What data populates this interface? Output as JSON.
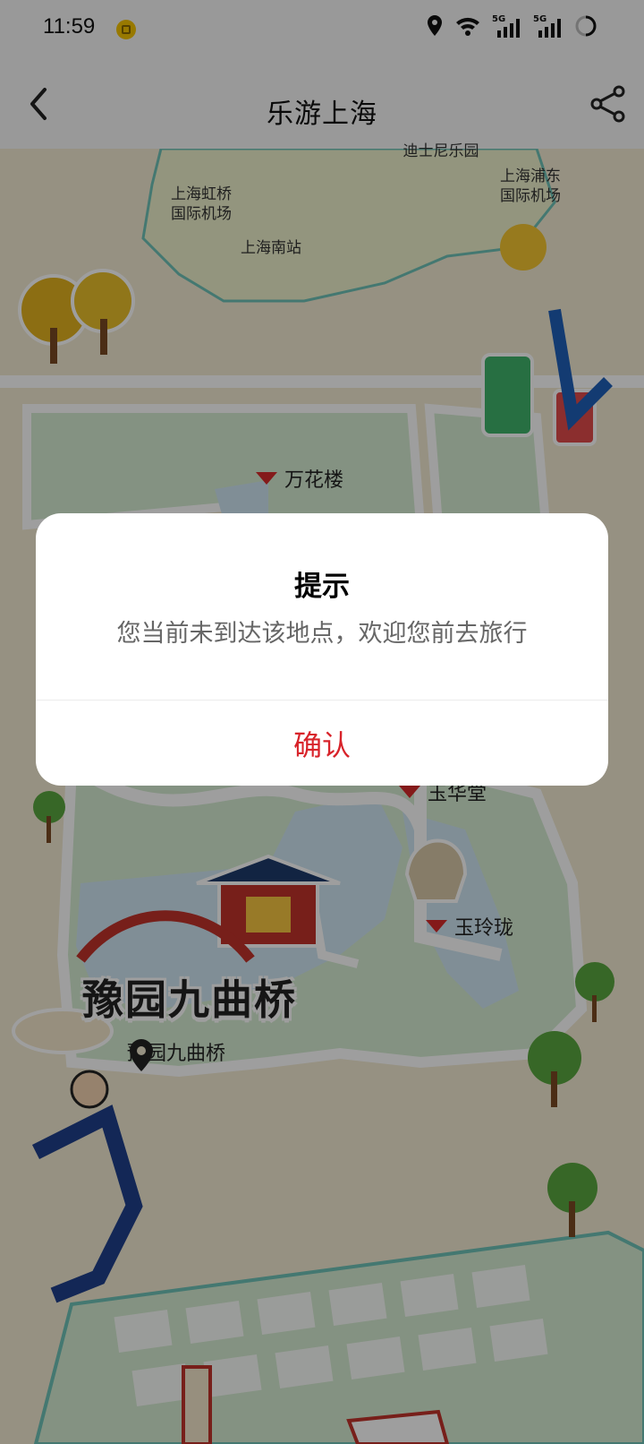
{
  "status_bar": {
    "time": "11:59",
    "network_1": "5G",
    "network_2": "5G"
  },
  "header": {
    "title": "乐游上海"
  },
  "map": {
    "labels": {
      "disney": "迪士尼乐园",
      "hongqiao": "上海虹桥\n国际机场",
      "pudong": "上海浦东\n国际机场",
      "south_station": "上海南站"
    },
    "pois": {
      "wanhualou": "万花楼",
      "yuhuatang": "玉华堂",
      "yulinglong": "玉玲珑"
    },
    "featured_title": "豫园九曲桥",
    "pin_label": "豫园九曲桥"
  },
  "dialog": {
    "title": "提示",
    "message": "您当前未到达该地点，欢迎您前去旅行",
    "confirm_label": "确认"
  },
  "colors": {
    "accent": "#d8232a",
    "map_background": "#f2ead2",
    "water": "#cfe6f2",
    "park": "#d6ecd2"
  }
}
